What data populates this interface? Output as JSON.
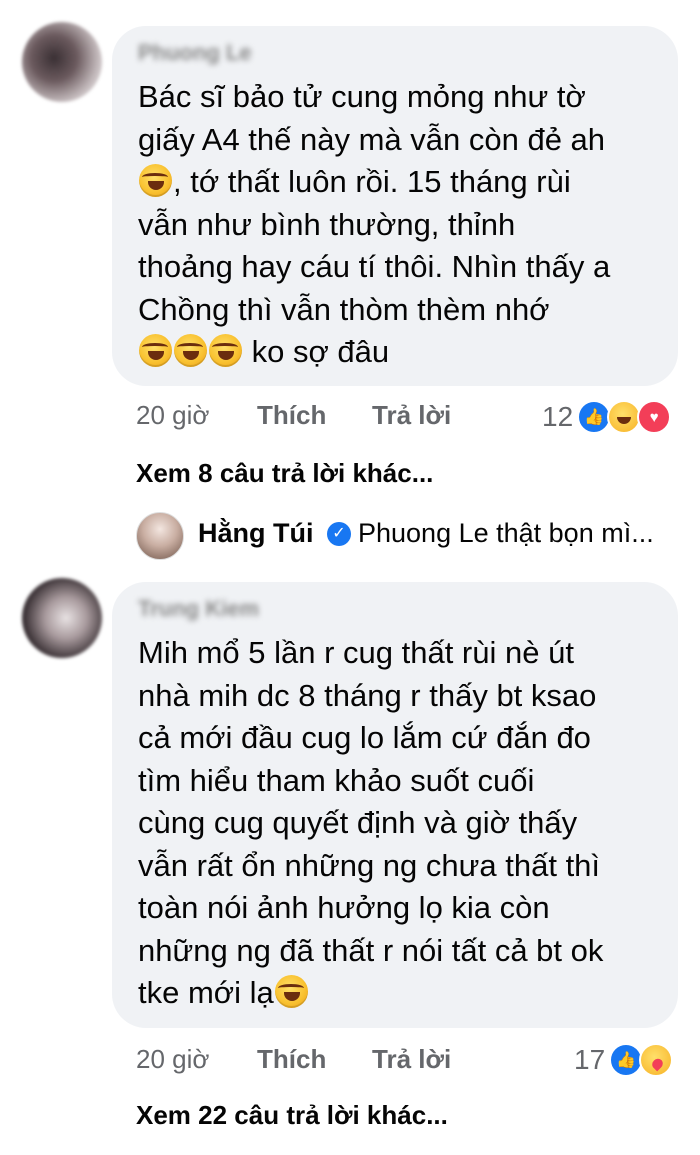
{
  "comments": [
    {
      "author": "Phuong Le",
      "text_lines": [
        "Bác sĩ bảo tử cung mỏng như tờ",
        "giấy A4 thế này mà vẫn còn đẻ ah",
        "",
        "vẫn như bình thường, thỉnh",
        "thoảng hay cáu tí thôi. Nhìn thấy a",
        "Chồng thì vẫn thòm thèm nhớ",
        ""
      ],
      "line3_tail": ", tớ thất luôn rồi. 15 tháng rùi",
      "line7_tail": " ko sợ đâu",
      "time": "20 giờ",
      "like_label": "Thích",
      "reply_label": "Trả lời",
      "reaction_count": "12",
      "reactions": [
        "like-icon",
        "haha-icon",
        "love-icon"
      ],
      "more_replies": "Xem 8 câu trả lời khác..."
    },
    {
      "author": "Trung Kiem",
      "text_lines": [
        "Mih mổ 5 lần r cug thất rùi nè út",
        "nhà mih dc 8 tháng r thấy bt ksao",
        "cả mới đầu cug lo lắm cứ đắn đo",
        "tìm hiểu tham khảo suốt cuối",
        "cùng cug quyết định và giờ thấy",
        "vẫn rất ổn những ng chưa thất thì",
        "toàn nói ảnh hưởng lọ kia còn",
        "những ng đã thất r nói tất cả bt ok",
        "tke mới lạ"
      ],
      "time": "20 giờ",
      "like_label": "Thích",
      "reply_label": "Trả lời",
      "reaction_count": "17",
      "reactions": [
        "like-icon",
        "care-icon"
      ],
      "more_replies": "Xem 22 câu trả lời khác..."
    }
  ],
  "reply_preview": {
    "author": "Hằng Túi",
    "text": "Phuong Le thật bọn mì..."
  }
}
